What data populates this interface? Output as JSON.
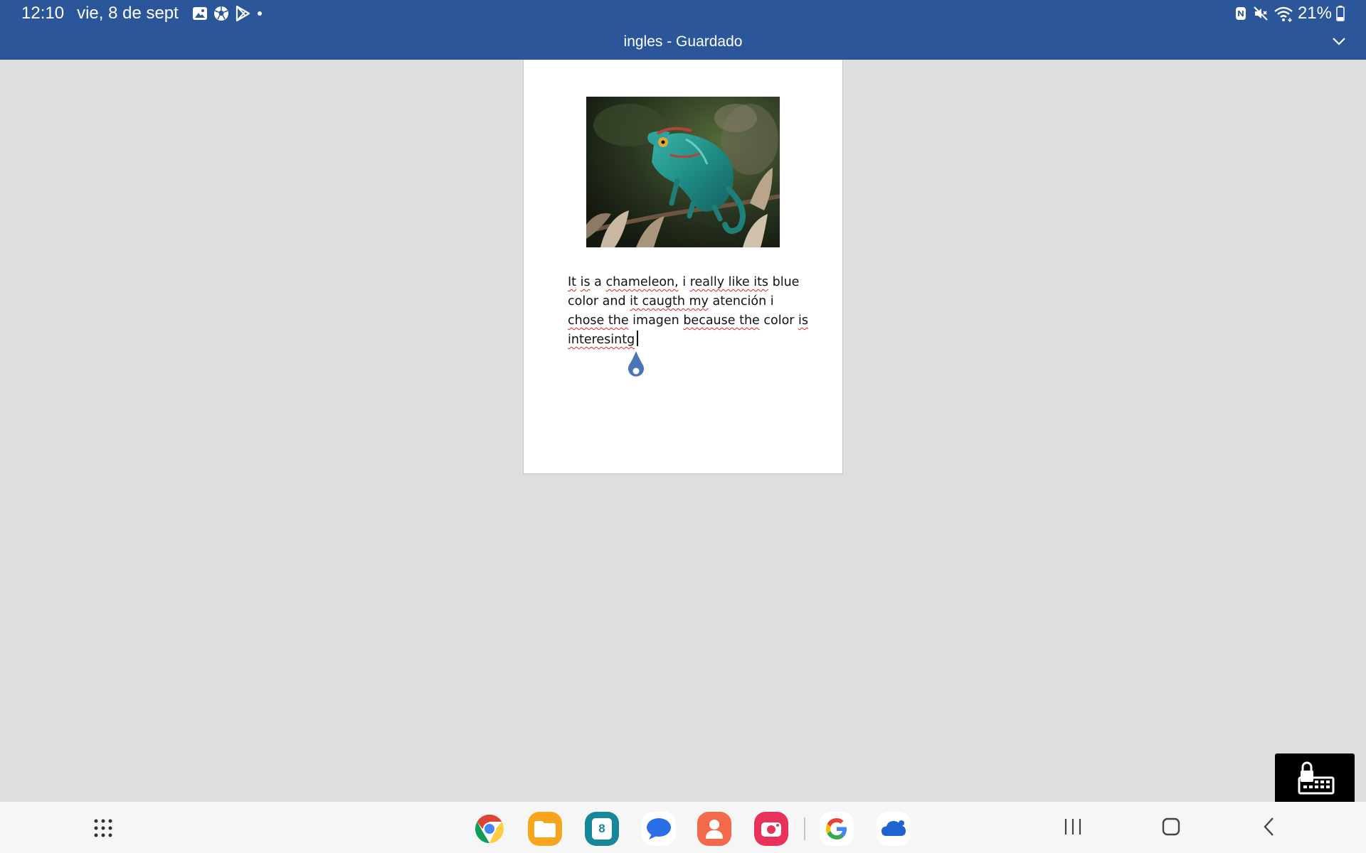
{
  "status_bar": {
    "time": "12:10",
    "date": "vie, 8 de sept",
    "battery": "21%",
    "notification_icons": [
      "gallery-icon",
      "soccer-ball-icon",
      "play-store-icon"
    ],
    "system_icons": [
      "nfc-icon",
      "mute-icon",
      "wifi-icon",
      "battery-icon"
    ]
  },
  "title_bar": {
    "document_title": "ingles - Guardado",
    "chevron_icon": "chevron-down-icon"
  },
  "document": {
    "image_alt": "chameleon photo",
    "paragraph": {
      "w1": "It",
      "w2": "is",
      "t3": " a ",
      "w4": "chameleon,",
      "t5": " i ",
      "w6": "really like its",
      "t7": " blue",
      "t8": "color and ",
      "w9": "it caugth my",
      "t10": " atención i",
      "w11": "chose the",
      "t12": " imagen ",
      "w13": "because the",
      "t14": " color ",
      "w15": "is",
      "w16": "interesintg"
    }
  },
  "taskbar": {
    "apps": [
      "Chrome",
      "My Files",
      "Calendar",
      "Messages",
      "Contacts",
      "Screen Recorder",
      "Google",
      "OneDrive"
    ],
    "calendar_day": "8",
    "nav": [
      "apps-grid-icon",
      "recents-icon",
      "home-icon",
      "back-icon"
    ]
  },
  "colors": {
    "header_blue": "#2b579a",
    "canvas_gray": "#dedede",
    "handle_blue": "#4a74b8",
    "spellcheck_red": "#d22222"
  }
}
